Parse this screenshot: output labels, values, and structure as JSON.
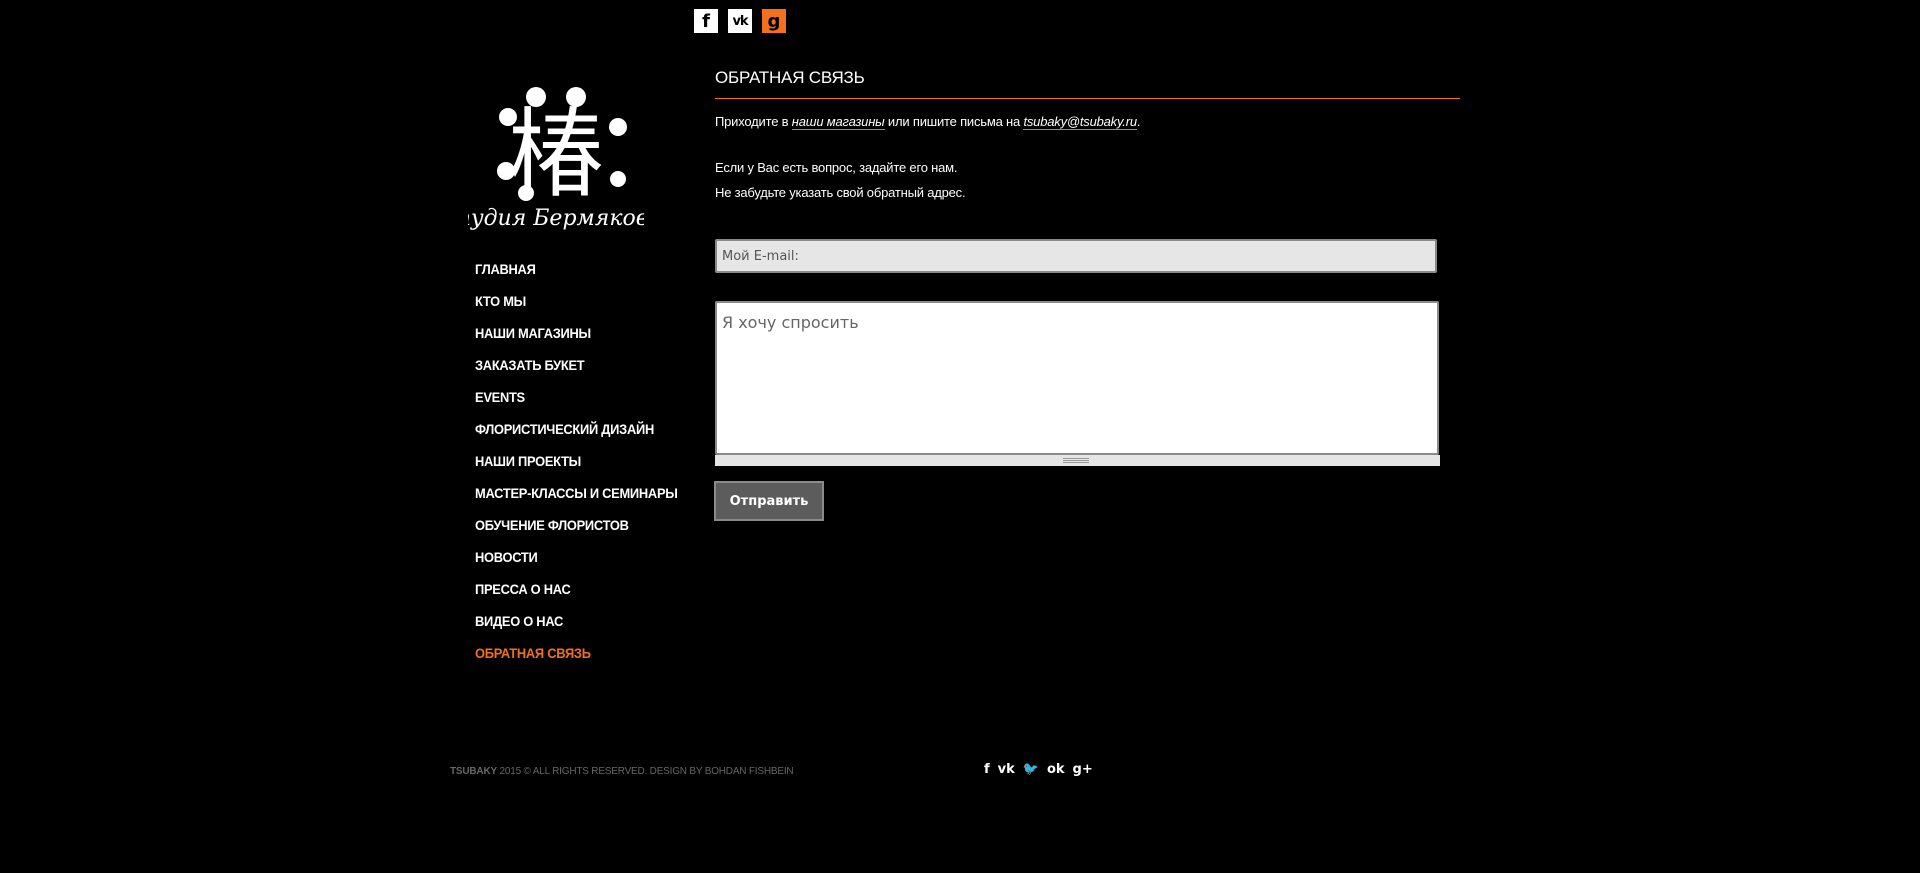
{
  "header": {
    "social": [
      {
        "name": "facebook-icon",
        "glyph": "f"
      },
      {
        "name": "vk-icon",
        "glyph": "vk"
      },
      {
        "name": "odnoklassniki-icon",
        "glyph": "g"
      }
    ]
  },
  "logo": {
    "caption": "Студия Бермяковых",
    "mark": "椿"
  },
  "nav": {
    "items": [
      "ГЛАВНАЯ",
      "КТО МЫ",
      "НАШИ МАГАЗИНЫ",
      "ЗАКАЗАТЬ БУКЕТ",
      "EVENTS",
      "ФЛОРИСТИЧЕСКИЙ ДИЗАЙН",
      "НАШИ ПРОЕКТЫ",
      "МАСТЕР-КЛАССЫ И СЕМИНАРЫ",
      "ОБУЧЕНИЕ ФЛОРИСТОВ",
      "НОВОСТИ",
      "ПРЕССА О НАС",
      "ВИДЕО О НАС",
      "ОБРАТНАЯ СВЯЗЬ"
    ],
    "active_color": "#f37021"
  },
  "content": {
    "title": "ОБРАТНАЯ СВЯЗЬ",
    "intro_before": "Приходите в ",
    "intro_link_shops": "наши магазины",
    "intro_middle": " или пишите письма на ",
    "intro_link_email": "tsubaky@tsubaky.ru",
    "intro_after": ".",
    "question_line1": "Если у Вас есть вопрос, задайте его нам.",
    "question_line2": "Не забудьте указать свой обратный адрес."
  },
  "form": {
    "email_placeholder": "Мой E-mail:",
    "message_placeholder": "Я хочу спросить",
    "submit_label": "Отправить"
  },
  "footer": {
    "brand": "TSUBAKY",
    "copyright": " 2015 © ALL RIGHTS RESERVED. DESIGN BY BOHDAN FISHBEIN",
    "social": [
      {
        "name": "facebook-icon",
        "glyph": "f"
      },
      {
        "name": "vk-icon",
        "glyph": "vk"
      },
      {
        "name": "twitter-icon",
        "glyph": "🐦"
      },
      {
        "name": "odnoklassniki-icon",
        "glyph": "ok"
      },
      {
        "name": "google-plus-icon",
        "glyph": "g+"
      }
    ]
  },
  "colors": {
    "accent": "#f37021",
    "background": "#000000"
  }
}
